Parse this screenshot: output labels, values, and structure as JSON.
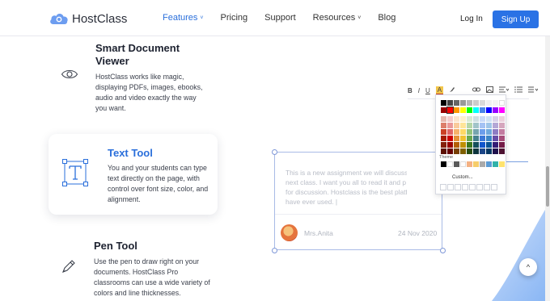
{
  "header": {
    "brand": "HostClass",
    "nav": [
      {
        "label": "Features",
        "has_dropdown": true,
        "active": true
      },
      {
        "label": "Pricing",
        "has_dropdown": false,
        "active": false
      },
      {
        "label": "Support",
        "has_dropdown": false,
        "active": false
      },
      {
        "label": "Resources",
        "has_dropdown": true,
        "active": false
      },
      {
        "label": "Blog",
        "has_dropdown": false,
        "active": false
      }
    ],
    "chevron": "˅",
    "login": "Log In",
    "signup": "Sign Up"
  },
  "features": [
    {
      "title_line1": "Smart Document",
      "title_line2": "Viewer",
      "desc": [
        "HostClass works like magic,",
        "displaying PDFs, images, ebooks,",
        "audio and video exactly the way",
        "you want."
      ],
      "icon": "eye-icon"
    },
    {
      "title": "Text Tool",
      "desc": [
        "You and your students can type",
        "text directly on the page, with",
        "control over font size, color, and",
        "alignment."
      ],
      "icon": "text-tool-icon"
    },
    {
      "title": "Pen Tool",
      "desc": [
        "Use the pen to draw right on your",
        "documents. HostClass Pro",
        "classrooms can use a wide variety of",
        "colors and line thicknesses."
      ],
      "icon": "pen-icon"
    }
  ],
  "editor": {
    "lines": [
      "This is a new assignment we will discuss",
      "next class. I want you all to read it and p",
      "for discussion. Hostclass is the best platf",
      "have ever used. |"
    ],
    "author": "Mrs.Anita",
    "date": "24 Nov 2020"
  },
  "toolbar": {
    "bold": "B",
    "italic": "I",
    "underline": "U",
    "text_color": "A"
  },
  "color_picker": {
    "theme_label": "Theme",
    "custom_label": "Custom...",
    "top_row": [
      "#000000",
      "#444444",
      "#666666",
      "#999999",
      "#b7b7b7",
      "#cccccc",
      "#d9d9d9",
      "#efefef",
      "#f3f3f3",
      "#ffffff"
    ],
    "bright_row": [
      "#980000",
      "#ff0000",
      "#ff9900",
      "#ffff00",
      "#00ff00",
      "#00ffff",
      "#4a86e8",
      "#0000ff",
      "#9900ff",
      "#ff00ff"
    ],
    "shade_rows": [
      [
        "#e6b8af",
        "#f4cccc",
        "#fce5cd",
        "#fff2cc",
        "#d9ead3",
        "#d0e0e3",
        "#c9daf8",
        "#cfe2f3",
        "#d9d2e9",
        "#ead1dc"
      ],
      [
        "#dd7e6b",
        "#ea9999",
        "#f9cb9c",
        "#ffe599",
        "#b6d7a8",
        "#a2c4c9",
        "#a4c2f4",
        "#9fc5e8",
        "#b4a7d6",
        "#d5a6bd"
      ],
      [
        "#cc4125",
        "#e06666",
        "#f6b26b",
        "#ffd966",
        "#93c47d",
        "#76a5af",
        "#6d9eeb",
        "#6fa8dc",
        "#8e7cc3",
        "#c27ba0"
      ],
      [
        "#a61c00",
        "#cc0000",
        "#e69138",
        "#f1c232",
        "#6aa84f",
        "#45818e",
        "#3c78d8",
        "#3d85c6",
        "#674ea7",
        "#a64d79"
      ],
      [
        "#85200c",
        "#990000",
        "#b45f06",
        "#bf9000",
        "#38761d",
        "#134f5c",
        "#1155cc",
        "#0b5394",
        "#351c75",
        "#741b47"
      ],
      [
        "#5b0f00",
        "#660000",
        "#783f04",
        "#7f6000",
        "#274e13",
        "#0c343d",
        "#1c4587",
        "#073763",
        "#20124d",
        "#4c1130"
      ]
    ],
    "theme_row": [
      "#000000",
      "#ffffff",
      "#595959",
      "#ffffff",
      "#f4b183",
      "#f6cd6a",
      "#aaaaaa",
      "#5b9bd5",
      "#31b2a9",
      "#ffe36e"
    ]
  },
  "scroll_top_icon": "^"
}
